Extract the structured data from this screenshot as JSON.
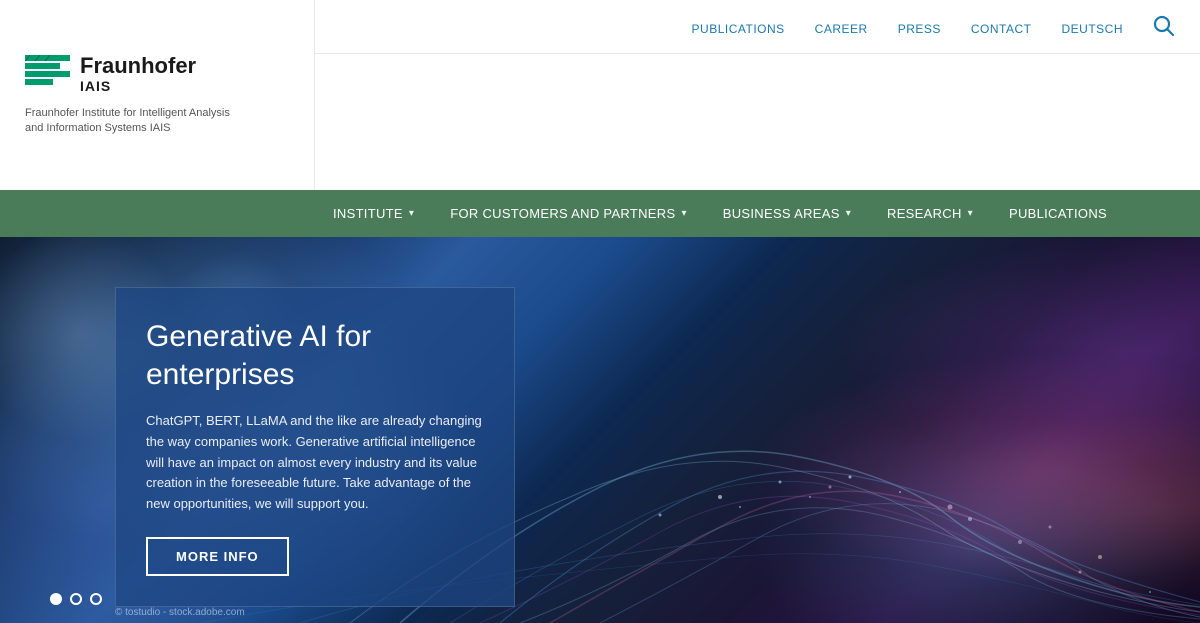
{
  "logo": {
    "name": "Fraunhofer",
    "sub": "IAIS",
    "description_line1": "Fraunhofer Institute for Intelligent Analysis",
    "description_line2": "and Information Systems IAIS"
  },
  "top_nav": {
    "links": [
      {
        "label": "PUBLICATIONS",
        "id": "publications"
      },
      {
        "label": "CAREER",
        "id": "career"
      },
      {
        "label": "PRESS",
        "id": "press"
      },
      {
        "label": "CONTACT",
        "id": "contact"
      },
      {
        "label": "DEUTSCH",
        "id": "deutsch"
      }
    ]
  },
  "green_nav": {
    "items": [
      {
        "label": "INSTITUTE",
        "has_chevron": true
      },
      {
        "label": "FOR CUSTOMERS AND PARTNERS",
        "has_chevron": true
      },
      {
        "label": "BUSINESS AREAS",
        "has_chevron": true
      },
      {
        "label": "RESEARCH",
        "has_chevron": true
      },
      {
        "label": "PUBLICATIONS",
        "has_chevron": false
      }
    ]
  },
  "hero": {
    "title": "Generative AI for enterprises",
    "body": "ChatGPT, BERT, LLaMA and the like are already changing the way companies work. Generative artificial intelligence will have an impact on almost every industry and its value creation in the foreseeable future. Take advantage of the new opportunities, we will support you.",
    "cta_label": "MORE INFO",
    "dots": [
      {
        "active": true
      },
      {
        "active": false
      },
      {
        "active": false
      }
    ],
    "copyright": "© tostudio - stock.adobe.com"
  }
}
